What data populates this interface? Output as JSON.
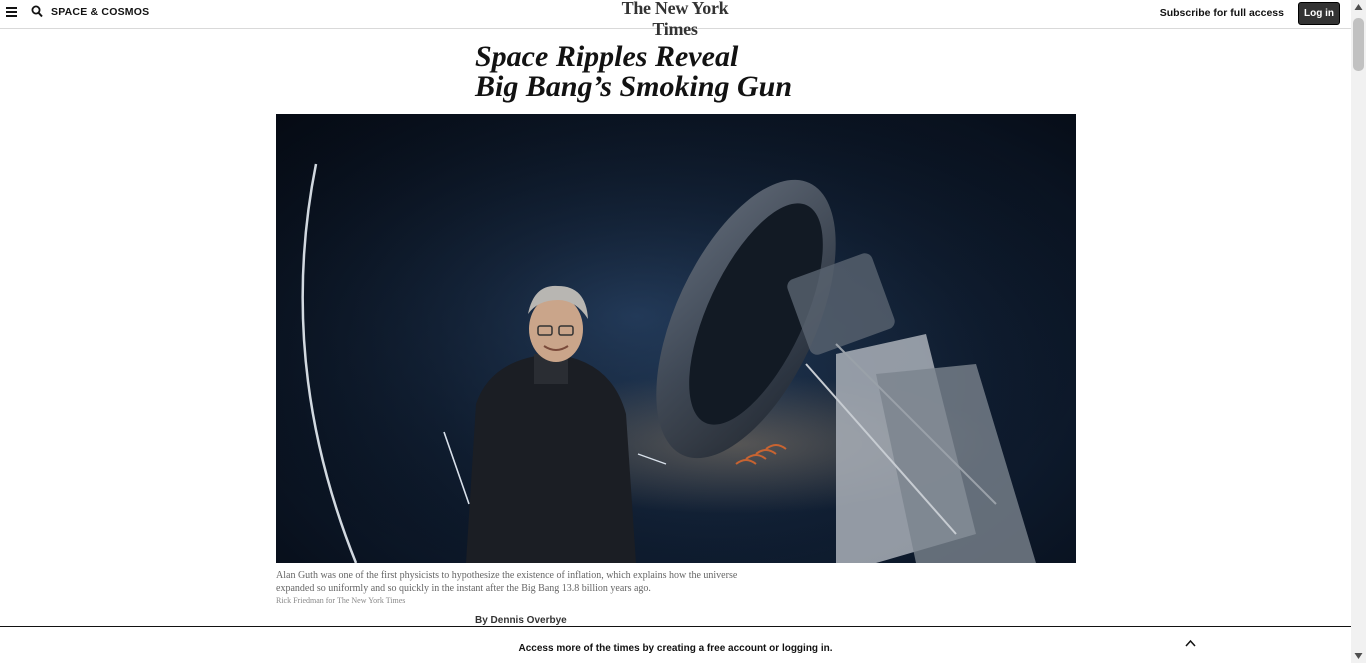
{
  "header": {
    "section": "SPACE & COSMOS",
    "logo": "The New York Times",
    "subscribe_label": "Subscribe for full access",
    "login_label": "Log in"
  },
  "article": {
    "headline_line1": "Space Ripples Reveal",
    "headline_line2": "Big Bang’s Smoking Gun",
    "image_alt": "Alan Guth standing in front of a telescope at night",
    "caption": "Alan Guth was one of the first physicists to hypothesize the existence of inflation, which explains how the universe expanded so uniformly and so quickly in the instant after the Big Bang 13.8 billion years ago.",
    "credit": "Rick Friedman for The New York Times",
    "byline": "By Dennis Overbye"
  },
  "gateway": {
    "message": "Access more of the times by creating a free account or logging in."
  }
}
